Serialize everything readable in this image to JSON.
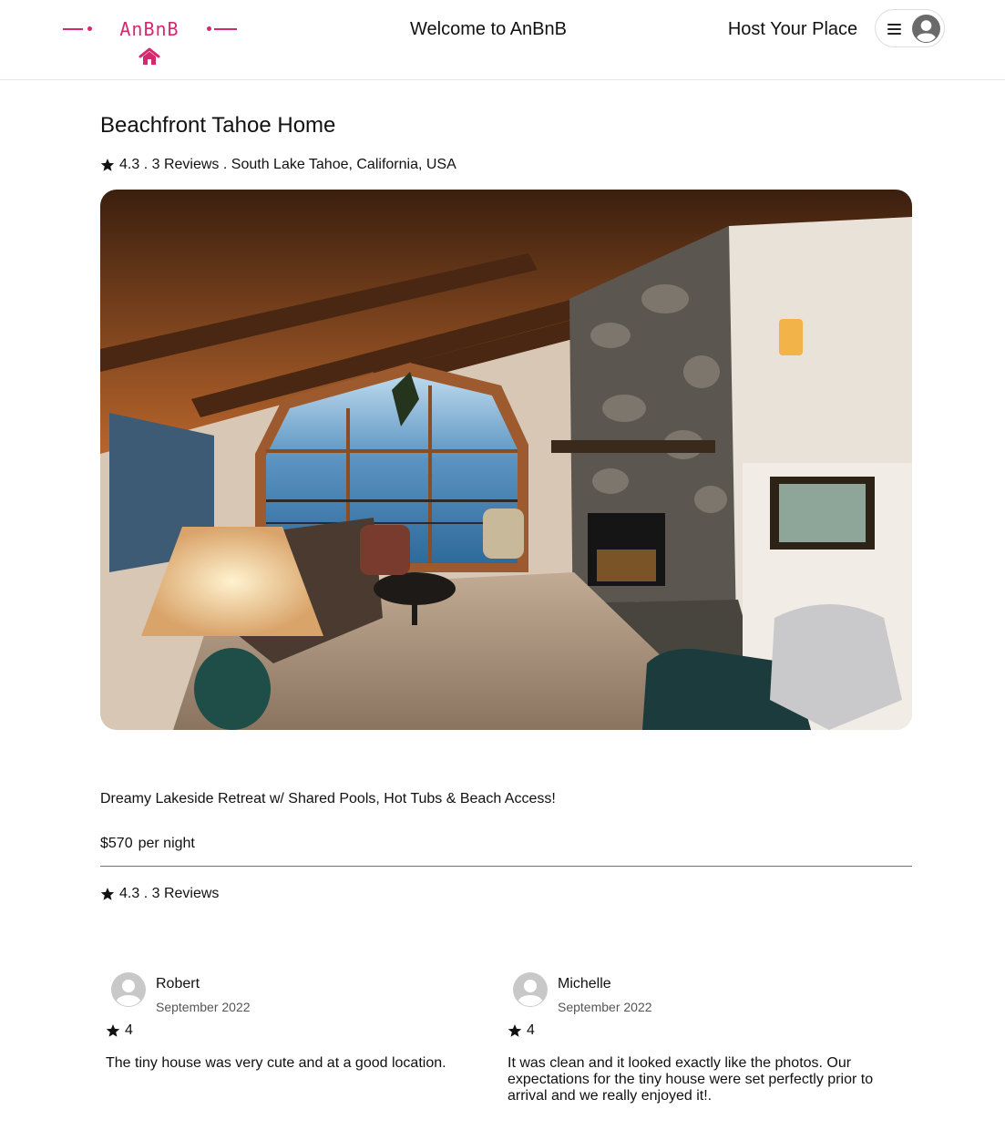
{
  "header": {
    "logo_text": "AnBnB",
    "welcome": "Welcome to AnBnB",
    "host_link": "Host Your Place",
    "menu_icon": "hamburger-icon",
    "avatar_icon": "user-avatar-icon"
  },
  "listing": {
    "title": "Beachfront Tahoe Home",
    "rating": "4.3",
    "sep1": ".",
    "reviews_count": "3 Reviews",
    "sep2": ".",
    "location": "South Lake Tahoe, California, USA",
    "description": "Dreamy Lakeside Retreat w/ Shared Pools, Hot Tubs & Beach Access!",
    "price": "$570",
    "price_unit": "per night"
  },
  "reviews_summary": {
    "rating": "4.3",
    "sep": ".",
    "count": "3 Reviews"
  },
  "reviews": [
    {
      "name": "Robert",
      "date": "September 2022",
      "rating": "4",
      "text": "The tiny house was very cute and at a good location."
    },
    {
      "name": "Michelle",
      "date": "September 2022",
      "rating": "4",
      "text": "It was clean and it looked exactly like the photos. Our expectations for the tiny house were set perfectly prior to arrival and we really enjoyed it!."
    }
  ],
  "colors": {
    "brand": "#d6286f",
    "text": "#111111",
    "muted": "#555555",
    "divider": "#6f6f6f"
  }
}
